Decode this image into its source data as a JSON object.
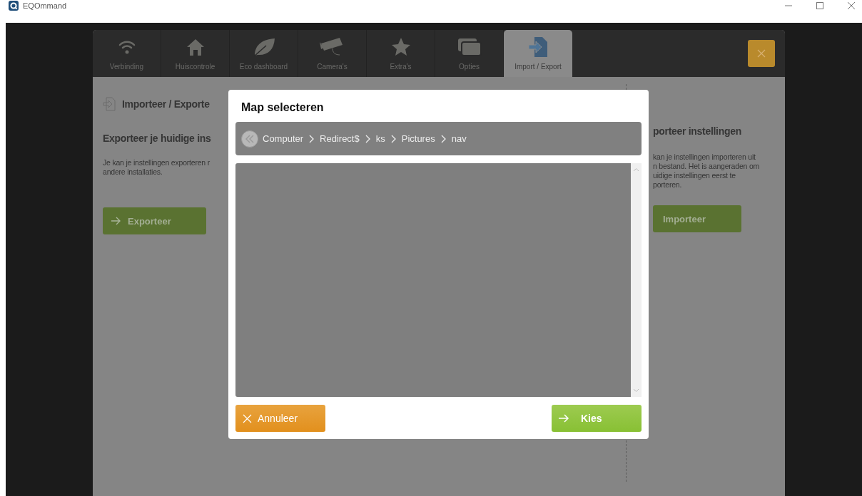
{
  "window": {
    "title": "EQOmmand"
  },
  "tabs": [
    {
      "label": "Verbinding",
      "kind": "wifi",
      "selected": false
    },
    {
      "label": "Huiscontrole",
      "kind": "house",
      "selected": false
    },
    {
      "label": "Eco dashboard",
      "kind": "leaf",
      "selected": false
    },
    {
      "label": "Camera's",
      "kind": "camera",
      "selected": false
    },
    {
      "label": "Extra's",
      "kind": "star",
      "selected": false
    },
    {
      "label": "Opties",
      "kind": "windows",
      "selected": false
    },
    {
      "label": "Import / Export",
      "kind": "import",
      "selected": true
    }
  ],
  "page": {
    "title": "Importeer / Exporte",
    "export": {
      "heading": "Exporteer je huidige ins",
      "lines": [
        "Je kan je instellingen exporteren r",
        "andere installaties."
      ],
      "button": "Exporteer"
    },
    "import": {
      "heading": "porteer instellingen",
      "lines": [
        "kan je instellingen importeren uit",
        "n bestand. Het is aangeraden om",
        "uidige instellingen eerst te",
        "porteren."
      ],
      "button": "Importeer"
    }
  },
  "dialog": {
    "title": "Map selecteren",
    "breadcrumb": [
      "Computer",
      "Redirect$",
      "ks",
      "Pictures",
      "nav"
    ],
    "buttons": [
      {
        "label": "Annuleer",
        "kind": "cancel"
      },
      {
        "label": "Kies",
        "kind": "confirm"
      }
    ]
  }
}
